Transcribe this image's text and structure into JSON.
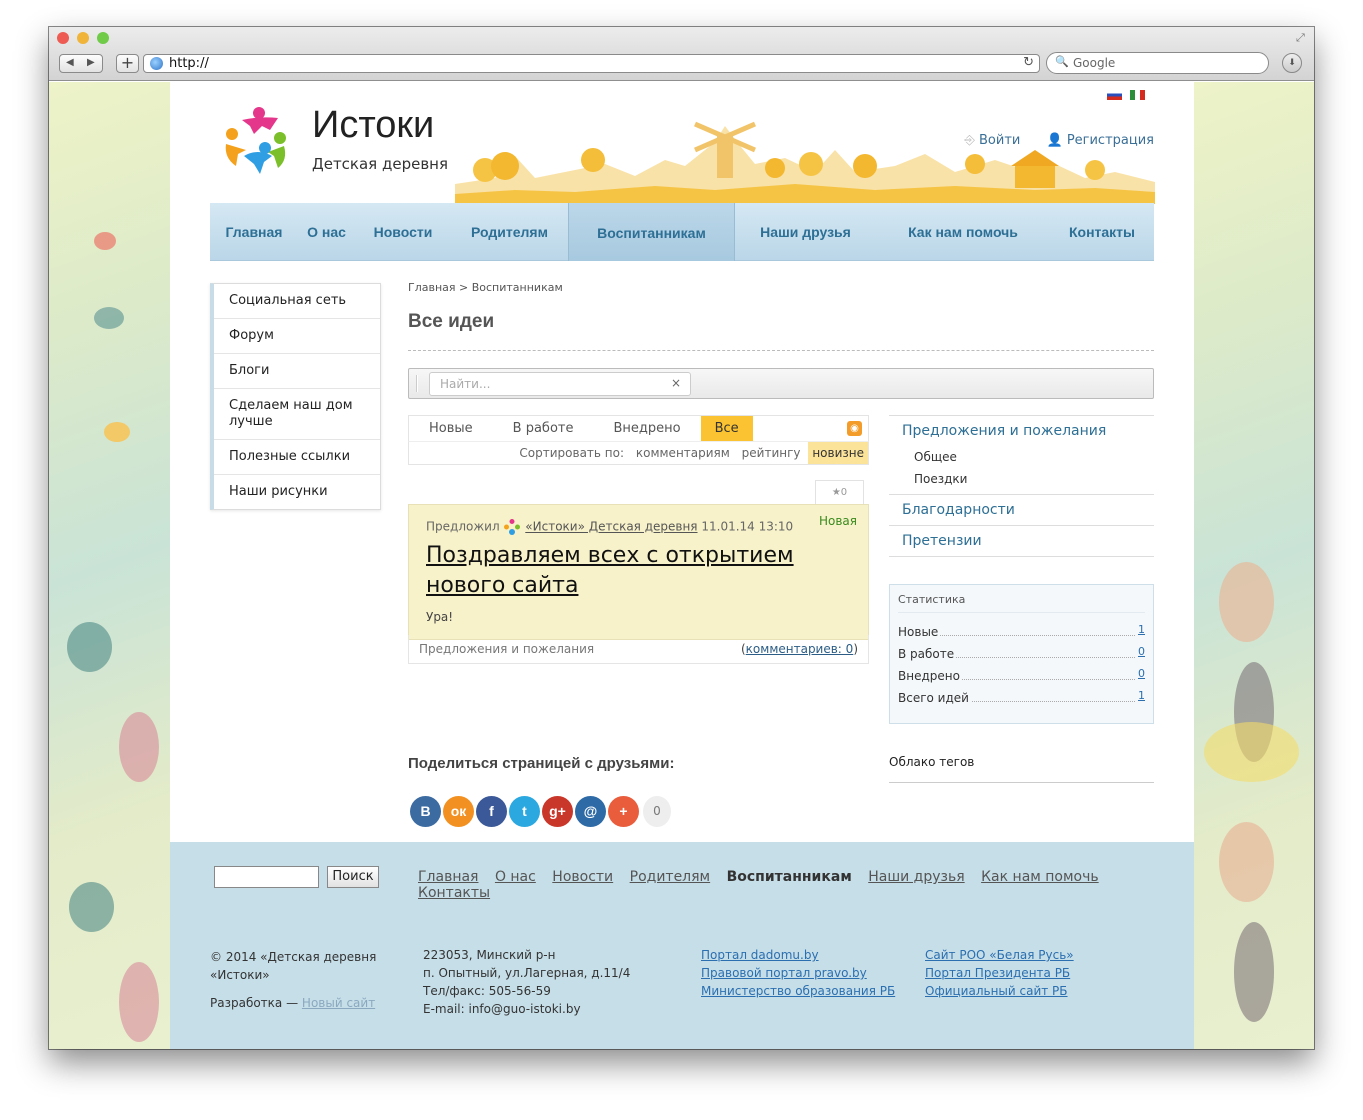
{
  "browser": {
    "url": "http://",
    "search_placeholder": "Google",
    "back": "◀",
    "forward": "▶",
    "plus": "+"
  },
  "site": {
    "title": "Истоки",
    "subtitle": "Детская деревня"
  },
  "auth": {
    "login": "Войти",
    "register": "Регистрация"
  },
  "nav": [
    "Главная",
    "О нас",
    "Новости",
    "Родителям",
    "Воспитанникам",
    "Наши друзья",
    "Как нам помочь",
    "Контакты"
  ],
  "sidebar": [
    "Социальная сеть",
    "Форум",
    "Блоги",
    "Сделаем наш дом лучше",
    "Полезные ссылки",
    "Наши рисунки"
  ],
  "breadcrumb": "Главная > Воспитанникам",
  "page_title": "Все идеи",
  "idea_search": {
    "placeholder": "Найти...",
    "clear": "×"
  },
  "filters": {
    "tabs": [
      "Новые",
      "В работе",
      "Внедрено",
      "Все"
    ],
    "sort_label": "Сортировать по:",
    "sort": [
      "комментариям",
      "рейтингу",
      "новизне"
    ]
  },
  "idea": {
    "votes": "★0",
    "proposed_by": "Предложил",
    "author": "«Истоки» Детская деревня",
    "date": "11.01.14 13:10",
    "status": "Новая",
    "title": "Поздравляем всех с открытием нового сайта",
    "body": "Ура!",
    "category": "Предложения и пожелания",
    "comments_prefix": "(",
    "comments_link": "комментариев: 0",
    "comments_suffix": ")"
  },
  "categories": {
    "main": "Предложения и пожелания",
    "subs": [
      "Общее",
      "Поездки"
    ],
    "others": [
      "Благодарности",
      "Претензии"
    ]
  },
  "stats": {
    "title": "Статистика",
    "rows": [
      {
        "label": "Новые",
        "value": "1"
      },
      {
        "label": "В работе",
        "value": "0"
      },
      {
        "label": "Внедрено",
        "value": "0"
      },
      {
        "label": "Всего идей",
        "value": "1"
      }
    ]
  },
  "tags_title": "Облако тегов",
  "share": {
    "title": "Поделиться страницей с друзьями:",
    "count": "0",
    "buttons": [
      {
        "label": "В",
        "color": "#3b6ba1"
      },
      {
        "label": "ок",
        "color": "#f29121"
      },
      {
        "label": "f",
        "color": "#3b5998"
      },
      {
        "label": "t",
        "color": "#2ca8e0"
      },
      {
        "label": "g+",
        "color": "#c9362a"
      },
      {
        "label": "@",
        "color": "#2d6aa6"
      },
      {
        "label": "+",
        "color": "#e95d3c"
      }
    ]
  },
  "footer": {
    "search_button": "Поиск",
    "nav": [
      "Главная",
      "О нас",
      "Новости",
      "Родителям",
      "Воспитанникам",
      "Наши друзья",
      "Как нам помочь",
      "Контакты"
    ],
    "copyright": [
      "© 2014 «Детская деревня",
      "«Истоки»"
    ],
    "dev_label": "Разработка —",
    "dev_link": "Новый сайт",
    "address": [
      "223053, Минский р-н",
      "п. Опытный, ул.Лагерная, д.11/4",
      "Тел/факс: 505-56-59",
      "E-mail: info@guo-istoki.by"
    ],
    "links1": [
      "Портал dadomu.by",
      "Правовой портал pravo.by",
      "Министерство образования РБ"
    ],
    "links2": [
      "Сайт РОО «Белая Русь»",
      "Портал Президента РБ",
      "Официальный сайт РБ"
    ]
  }
}
